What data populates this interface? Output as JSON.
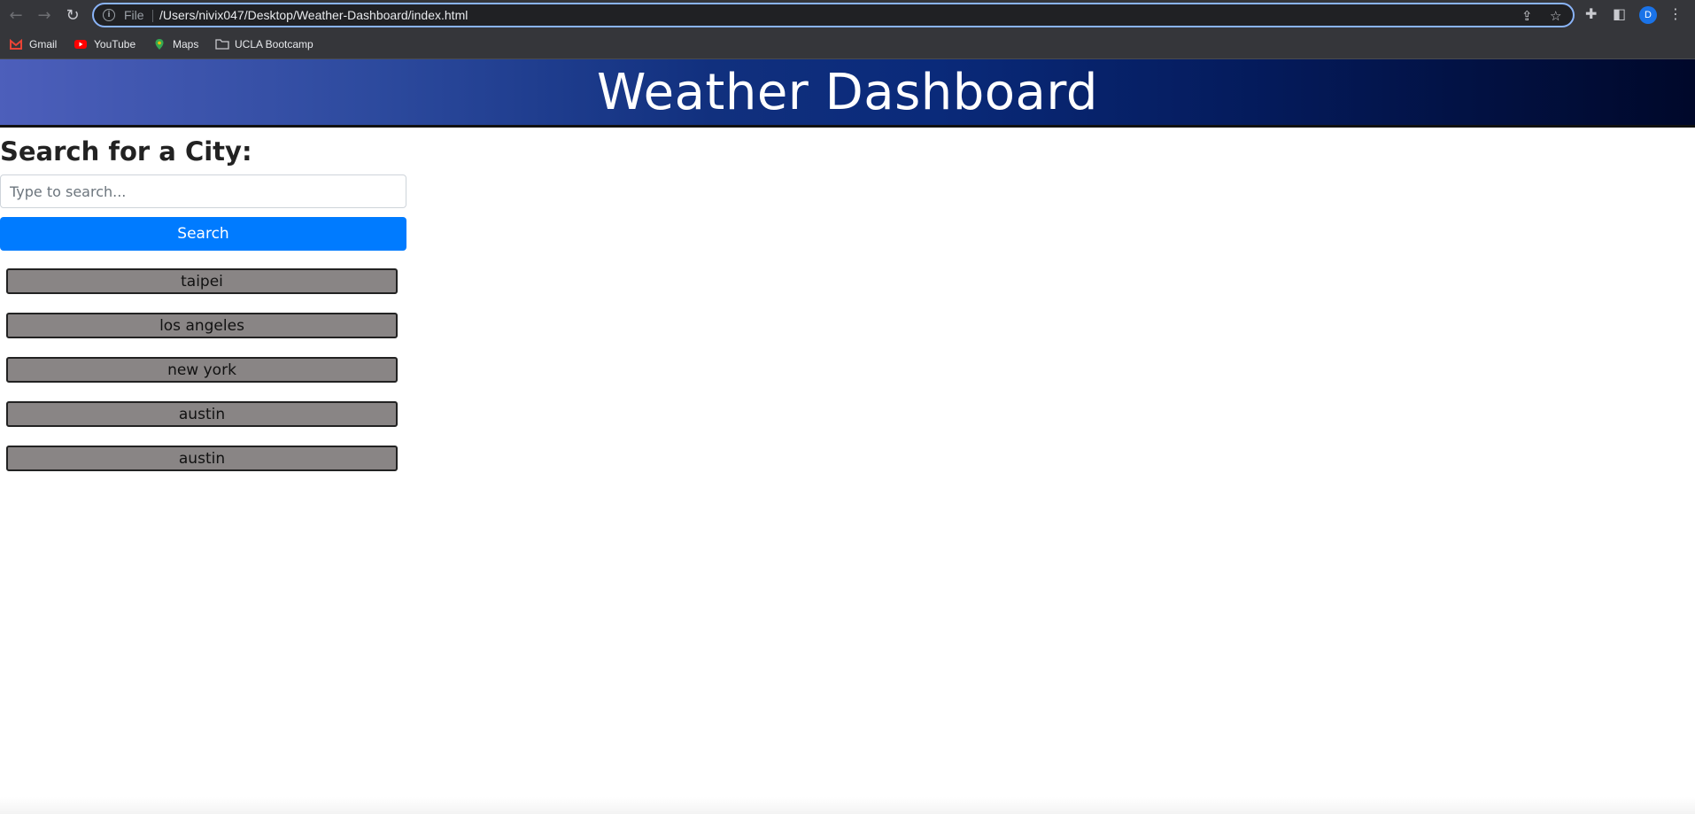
{
  "browser": {
    "file_label": "File",
    "url": "/Users/nivix047/Desktop/Weather-Dashboard/index.html",
    "avatar_initial": "D",
    "bookmarks": [
      {
        "label": "Gmail",
        "icon": "gmail-icon"
      },
      {
        "label": "YouTube",
        "icon": "youtube-icon"
      },
      {
        "label": "Maps",
        "icon": "maps-icon"
      },
      {
        "label": "UCLA Bootcamp",
        "icon": "folder-icon"
      }
    ]
  },
  "page": {
    "title": "Weather Dashboard",
    "search_heading": "Search for a City:",
    "search_placeholder": "Type to search...",
    "search_button": "Search",
    "history": [
      "taipei",
      "los angeles",
      "new york",
      "austin",
      "austin"
    ]
  },
  "colors": {
    "primary_button": "#007bff",
    "history_button": "#898585",
    "header_gradient_start": "#4d5fbb",
    "header_gradient_end": "#00082a"
  }
}
